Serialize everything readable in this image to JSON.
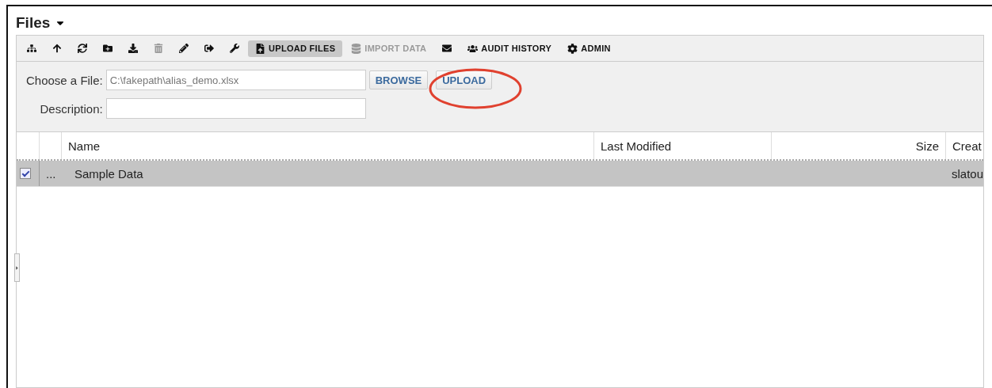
{
  "title": "Files",
  "toolbar": [
    {
      "kind": "icon",
      "disabled": false,
      "active": false
    },
    {
      "kind": "icon",
      "disabled": false,
      "active": false
    },
    {
      "kind": "icon",
      "disabled": false,
      "active": false
    },
    {
      "kind": "icon",
      "disabled": false,
      "active": false
    },
    {
      "kind": "icon",
      "disabled": false,
      "active": false
    },
    {
      "kind": "icon",
      "disabled": true,
      "active": false
    },
    {
      "kind": "icon",
      "disabled": false,
      "active": false
    },
    {
      "kind": "icon",
      "disabled": false,
      "active": false
    },
    {
      "kind": "icon",
      "disabled": false,
      "active": false
    },
    {
      "kind": "labeled",
      "label": "UPLOAD FILES",
      "disabled": false,
      "active": true
    },
    {
      "kind": "labeled",
      "label": "IMPORT DATA",
      "disabled": true,
      "active": false
    },
    {
      "kind": "icon",
      "disabled": false,
      "active": false
    },
    {
      "kind": "labeled",
      "label": "AUDIT HISTORY",
      "disabled": false,
      "active": false
    },
    {
      "kind": "labeled",
      "label": "ADMIN",
      "disabled": false,
      "active": false
    }
  ],
  "form": {
    "file_label": "Choose a File:",
    "file_value": "C:\\fakepath\\alias_demo.xlsx",
    "browse": "BROWSE",
    "upload": "UPLOAD",
    "description_label": "Description:"
  },
  "table": {
    "columns": [
      "Name",
      "Last Modified",
      "Size",
      "Creat"
    ],
    "rows": [
      {
        "selected": true,
        "checked": true,
        "menu": "...",
        "cells": [
          "Sample Data",
          "",
          "",
          "slatou"
        ]
      }
    ]
  }
}
